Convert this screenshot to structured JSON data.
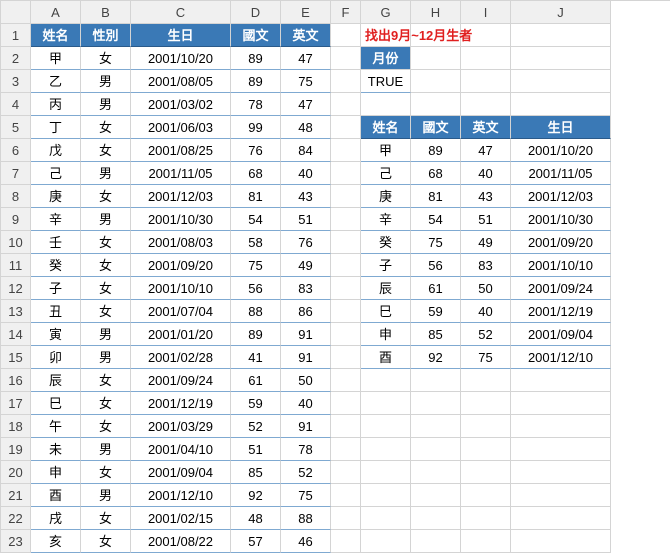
{
  "columns": [
    "A",
    "B",
    "C",
    "D",
    "E",
    "F",
    "G",
    "H",
    "I",
    "J"
  ],
  "rowCount": 23,
  "table1": {
    "headers": [
      "姓名",
      "性別",
      "生日",
      "國文",
      "英文"
    ],
    "rows": [
      [
        "甲",
        "女",
        "2001/10/20",
        "89",
        "47"
      ],
      [
        "乙",
        "男",
        "2001/08/05",
        "89",
        "75"
      ],
      [
        "丙",
        "男",
        "2001/03/02",
        "78",
        "47"
      ],
      [
        "丁",
        "女",
        "2001/06/03",
        "99",
        "48"
      ],
      [
        "戊",
        "女",
        "2001/08/25",
        "76",
        "84"
      ],
      [
        "己",
        "男",
        "2001/11/05",
        "68",
        "40"
      ],
      [
        "庚",
        "女",
        "2001/12/03",
        "81",
        "43"
      ],
      [
        "辛",
        "男",
        "2001/10/30",
        "54",
        "51"
      ],
      [
        "壬",
        "女",
        "2001/08/03",
        "58",
        "76"
      ],
      [
        "癸",
        "女",
        "2001/09/20",
        "75",
        "49"
      ],
      [
        "子",
        "女",
        "2001/10/10",
        "56",
        "83"
      ],
      [
        "丑",
        "女",
        "2001/07/04",
        "88",
        "86"
      ],
      [
        "寅",
        "男",
        "2001/01/20",
        "89",
        "91"
      ],
      [
        "卯",
        "男",
        "2001/02/28",
        "41",
        "91"
      ],
      [
        "辰",
        "女",
        "2001/09/24",
        "61",
        "50"
      ],
      [
        "巳",
        "女",
        "2001/12/19",
        "59",
        "40"
      ],
      [
        "午",
        "女",
        "2001/03/29",
        "52",
        "91"
      ],
      [
        "未",
        "男",
        "2001/04/10",
        "51",
        "78"
      ],
      [
        "申",
        "女",
        "2001/09/04",
        "85",
        "52"
      ],
      [
        "酉",
        "男",
        "2001/12/10",
        "92",
        "75"
      ],
      [
        "戌",
        "女",
        "2001/02/15",
        "48",
        "88"
      ],
      [
        "亥",
        "女",
        "2001/08/22",
        "57",
        "46"
      ]
    ]
  },
  "note": "找出9月~12月生者",
  "criteria": {
    "label": "月份",
    "value": "TRUE"
  },
  "table2": {
    "headers": [
      "姓名",
      "國文",
      "英文",
      "生日"
    ],
    "rows": [
      [
        "甲",
        "89",
        "47",
        "2001/10/20"
      ],
      [
        "己",
        "68",
        "40",
        "2001/11/05"
      ],
      [
        "庚",
        "81",
        "43",
        "2001/12/03"
      ],
      [
        "辛",
        "54",
        "51",
        "2001/10/30"
      ],
      [
        "癸",
        "75",
        "49",
        "2001/09/20"
      ],
      [
        "子",
        "56",
        "83",
        "2001/10/10"
      ],
      [
        "辰",
        "61",
        "50",
        "2001/09/24"
      ],
      [
        "巳",
        "59",
        "40",
        "2001/12/19"
      ],
      [
        "申",
        "85",
        "52",
        "2001/09/04"
      ],
      [
        "酉",
        "92",
        "75",
        "2001/12/10"
      ]
    ]
  }
}
